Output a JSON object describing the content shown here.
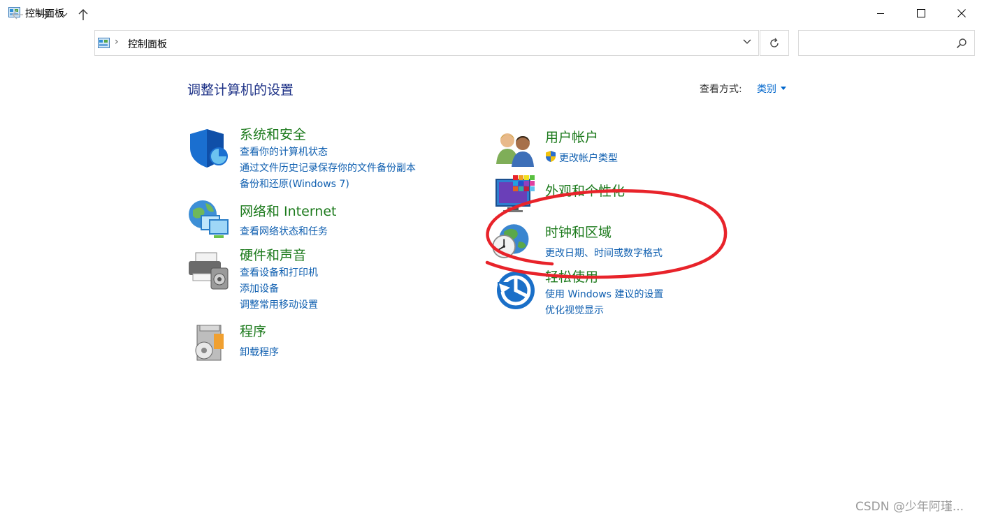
{
  "window": {
    "title": "控制面板"
  },
  "address": {
    "path": "控制面板",
    "separator": "›"
  },
  "search": {
    "placeholder": ""
  },
  "page": {
    "title": "调整计算机的设置",
    "view_by_label": "查看方式:",
    "view_by_value": "类别"
  },
  "categories": [
    {
      "title": "系统和安全",
      "icon": "shield-icon",
      "links": [
        "查看你的计算机状态",
        "通过文件历史记录保存你的文件备份副本",
        "备份和还原(Windows 7)"
      ]
    },
    {
      "title": "网络和 Internet",
      "icon": "network-icon",
      "links": [
        "查看网络状态和任务"
      ]
    },
    {
      "title": "硬件和声音",
      "icon": "printer-icon",
      "links": [
        "查看设备和打印机",
        "添加设备",
        "调整常用移动设置"
      ]
    },
    {
      "title": "程序",
      "icon": "programs-icon",
      "links": [
        "卸载程序"
      ]
    },
    {
      "title": "用户帐户",
      "icon": "users-icon",
      "links": [
        "更改帐户类型"
      ]
    },
    {
      "title": "外观和个性化",
      "icon": "appearance-icon",
      "links": []
    },
    {
      "title": "时钟和区域",
      "icon": "clock-globe-icon",
      "links": [
        "更改日期、时间或数字格式"
      ]
    },
    {
      "title": "轻松使用",
      "icon": "ease-of-access-icon",
      "links": [
        "使用 Windows 建议的设置",
        "优化视觉显示"
      ]
    }
  ],
  "colors": {
    "title_blue": "#1e3287",
    "category_green": "#1c7a1c",
    "link_blue": "#0f5fb0",
    "annotation_red": "#e8232a"
  },
  "watermark": "CSDN @少年阿瑾..."
}
